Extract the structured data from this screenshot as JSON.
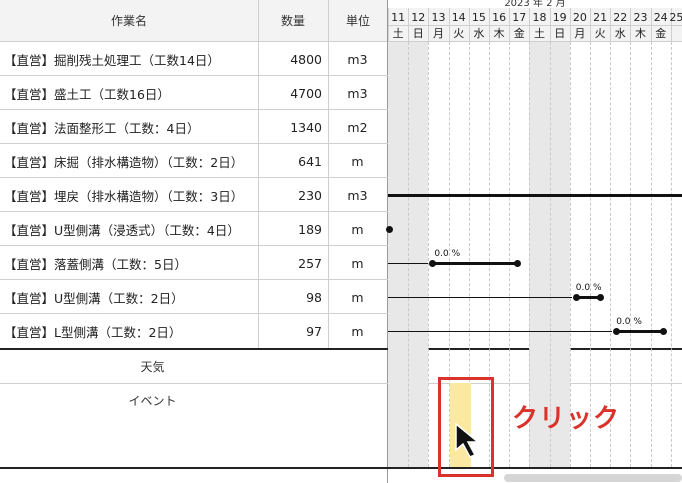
{
  "month_header": "2023 年 2 月",
  "columns": {
    "name": "作業名",
    "qty": "数量",
    "unit": "単位"
  },
  "days": [
    {
      "num": "11",
      "dow": "土"
    },
    {
      "num": "12",
      "dow": "日"
    },
    {
      "num": "13",
      "dow": "月"
    },
    {
      "num": "14",
      "dow": "火"
    },
    {
      "num": "15",
      "dow": "水"
    },
    {
      "num": "16",
      "dow": "木"
    },
    {
      "num": "17",
      "dow": "金"
    },
    {
      "num": "18",
      "dow": "土"
    },
    {
      "num": "19",
      "dow": "日"
    },
    {
      "num": "20",
      "dow": "月"
    },
    {
      "num": "21",
      "dow": "火"
    },
    {
      "num": "22",
      "dow": "水"
    },
    {
      "num": "23",
      "dow": "木"
    },
    {
      "num": "24",
      "dow": "金"
    },
    {
      "num": "25",
      "dow": ""
    }
  ],
  "rows": [
    {
      "name": "【直営】掘削残土処理工（工数14日）",
      "qty": "4800",
      "unit": "m3"
    },
    {
      "name": "【直営】盛土工（工数16日）",
      "qty": "4700",
      "unit": "m3"
    },
    {
      "name": "【直営】法面整形工（工数：4日）",
      "qty": "1340",
      "unit": "m2"
    },
    {
      "name": "【直営】床掘（排水構造物）（工数：2日）",
      "qty": "641",
      "unit": "m"
    },
    {
      "name": "【直営】埋戻（排水構造物）（工数：3日）",
      "qty": "230",
      "unit": "m3"
    },
    {
      "name": "【直営】U型側溝（浸透式）（工数：4日）",
      "qty": "189",
      "unit": "m"
    },
    {
      "name": "【直営】落蓋側溝（工数：5日）",
      "qty": "257",
      "unit": "m"
    },
    {
      "name": "【直営】U型側溝（工数：2日）",
      "qty": "98",
      "unit": "m"
    },
    {
      "name": "【直営】L型側溝（工数：2日）",
      "qty": "97",
      "unit": "m"
    }
  ],
  "weather_label": "天気",
  "event_label": "イベント",
  "progress_labels": [
    "0.0 %",
    "0.0 %",
    "0.0 %"
  ],
  "annotation": {
    "text": "クリック",
    "color": "#d9332b"
  },
  "highlight_color": "#fbe9a2",
  "icons": {
    "cursor": "arrow-cursor-icon"
  }
}
